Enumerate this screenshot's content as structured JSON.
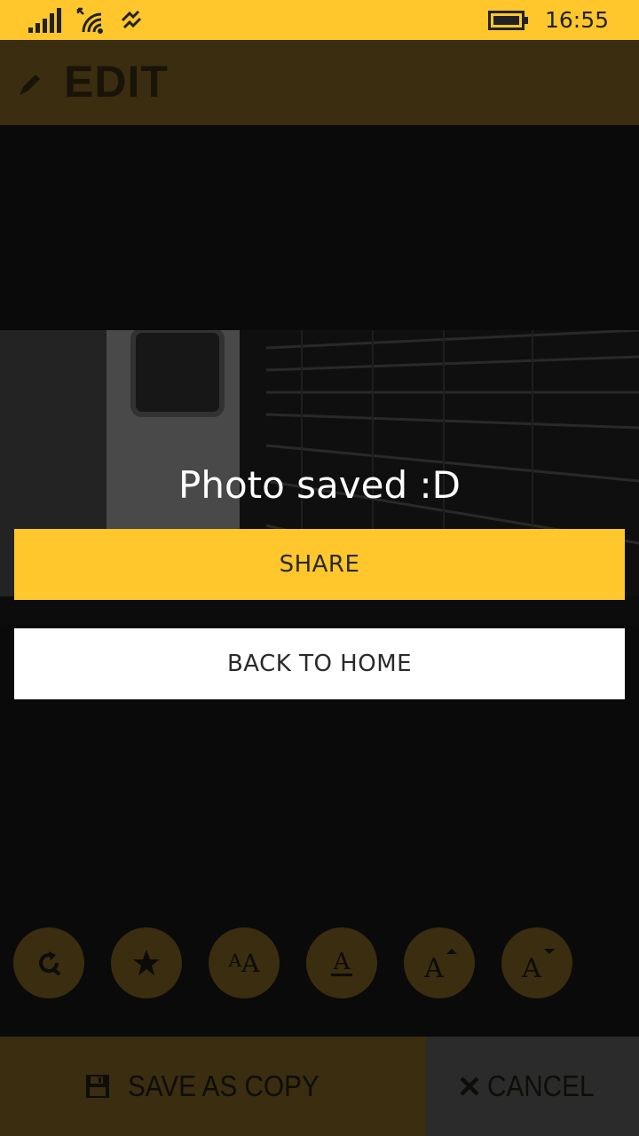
{
  "status_bar": {
    "time": "16:55",
    "icons": [
      "signal-bars-icon",
      "wifi-icon",
      "data-sync-icon",
      "battery-icon"
    ]
  },
  "header": {
    "title": "EDIT",
    "icon": "pencil-icon"
  },
  "dialog": {
    "message": "Photo saved :D",
    "share_label": "SHARE",
    "home_label": "BACK TO HOME"
  },
  "tools": [
    {
      "name": "rotate-icon"
    },
    {
      "name": "star-icon"
    },
    {
      "name": "font-size-icon",
      "text": "AA"
    },
    {
      "name": "text-color-icon",
      "text": "A"
    },
    {
      "name": "increase-size-icon",
      "text": "A"
    },
    {
      "name": "decrease-size-icon",
      "text": "A"
    }
  ],
  "bottom_bar": {
    "save_copy_label": "SAVE AS COPY",
    "cancel_label": "CANCEL"
  },
  "colors": {
    "accent": "#ffc72c",
    "header_bg": "#3a2d10",
    "cancel_bg": "#2b2b2b",
    "background": "#0a0a0a"
  }
}
